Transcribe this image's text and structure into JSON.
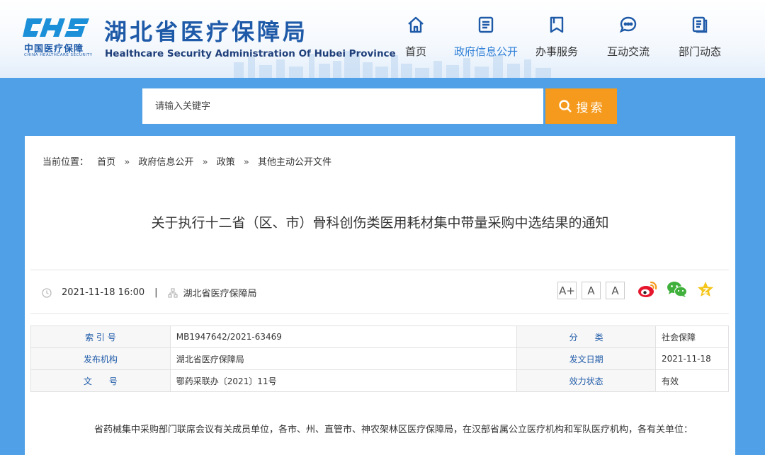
{
  "header": {
    "logo_text_cn": "中国医疗保障",
    "logo_text_en": "CHINA HEALTHCARE SECURITY",
    "title_cn": "湖北省医疗保障局",
    "title_en": "Healthcare Security Administration Of Hubei Province",
    "brand_color": "#1e5aa8",
    "accent_color": "#2e7fd6"
  },
  "nav": {
    "items": [
      {
        "label": "首页",
        "icon": "home-icon"
      },
      {
        "label": "政府信息公开",
        "icon": "document-icon",
        "active": true
      },
      {
        "label": "办事服务",
        "icon": "bookmark-icon"
      },
      {
        "label": "互动交流",
        "icon": "chat-icon"
      },
      {
        "label": "部门动态",
        "icon": "news-icon"
      }
    ]
  },
  "search": {
    "placeholder": "请输入关键字",
    "button_label": "搜索",
    "button_color": "#f59a1c"
  },
  "breadcrumb": {
    "prefix": "当前位置：",
    "items": [
      "首页",
      "政府信息公开",
      "政策",
      "其他主动公开文件"
    ],
    "separator": "»"
  },
  "article": {
    "title": "关于执行十二省（区、市）骨科创伤类医用耗材集中带量采购中选结果的通知",
    "date": "2021-11-18 16:00",
    "publisher": "湖北省医疗保障局",
    "font_sizes": [
      "A+",
      "A",
      "A"
    ],
    "share": [
      "weibo-icon",
      "wechat-icon",
      "favorite-icon"
    ]
  },
  "info": {
    "rows": [
      {
        "k1": "索 引 号",
        "v1": "MB1947642/2021-63469",
        "k2": "分　　类",
        "v2": "社会保障"
      },
      {
        "k1": "发布机构",
        "v1": "湖北省医疗保障局",
        "k2": "发文日期",
        "v2": "2021-11-18"
      },
      {
        "k1": "文　　号",
        "v1": "鄂药采联办〔2021〕11号",
        "k2": "效力状态",
        "v2": "有效"
      }
    ]
  },
  "body": {
    "paragraph": "省药械集中采购部门联席会议有关成员单位，各市、州、直管市、神农架林区医疗保障局，在汉部省属公立医疗机构和军队医疗机构，各有关单位："
  }
}
